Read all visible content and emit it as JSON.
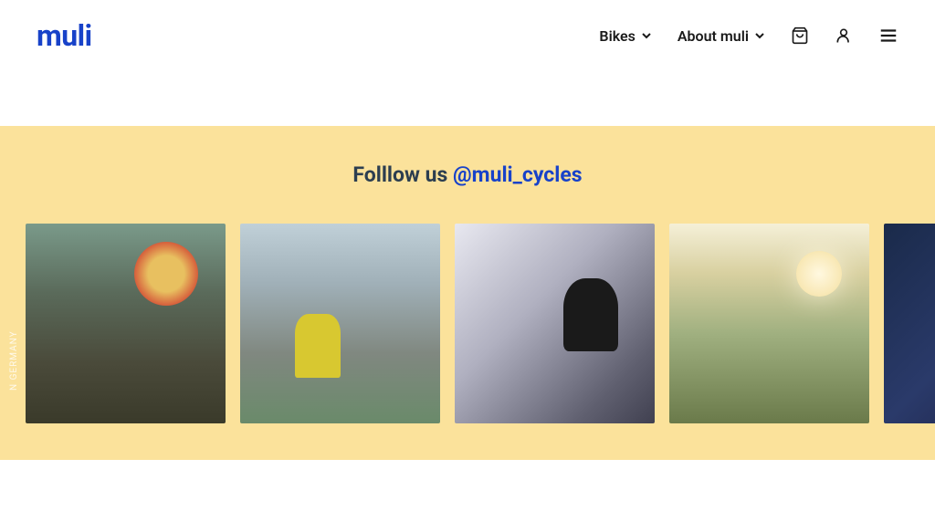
{
  "brand": {
    "name": "muli"
  },
  "nav": {
    "bikes_label": "Bikes",
    "about_label": "About muli"
  },
  "social": {
    "heading_prefix": "Folllow us ",
    "handle": "@muli_cycles",
    "side_text": "N GERMANY"
  }
}
